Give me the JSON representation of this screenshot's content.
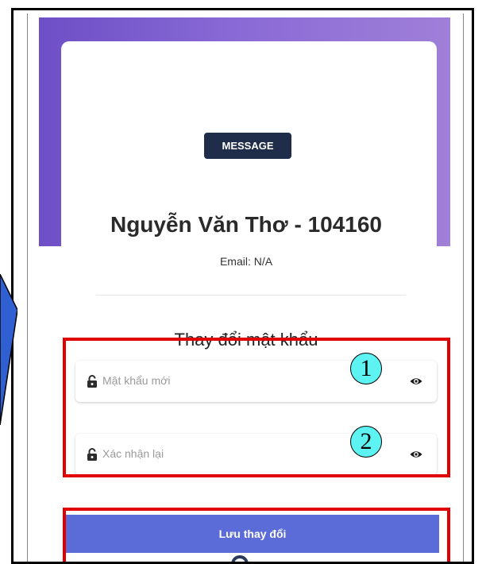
{
  "profile": {
    "badge": "MESSAGE",
    "name": "Nguyễn Văn Thơ - 104160",
    "email": "Email: N/A"
  },
  "change_password": {
    "title": "Thay đổi mật khẩu",
    "new_password": {
      "placeholder": "Mật khẩu mới",
      "callout": "1"
    },
    "confirm_password": {
      "placeholder": "Xác nhận lại",
      "callout": "2"
    }
  },
  "actions": {
    "save_label": "Lưu thay đổi"
  },
  "colors": {
    "header_gradient": [
      "#6e4fc6",
      "#a07fd8"
    ],
    "badge_bg": "#1f2d4a",
    "save_button_bg": "#5b6bd8",
    "highlight": "#e00000",
    "callout_fill": "#5ef3f3"
  }
}
